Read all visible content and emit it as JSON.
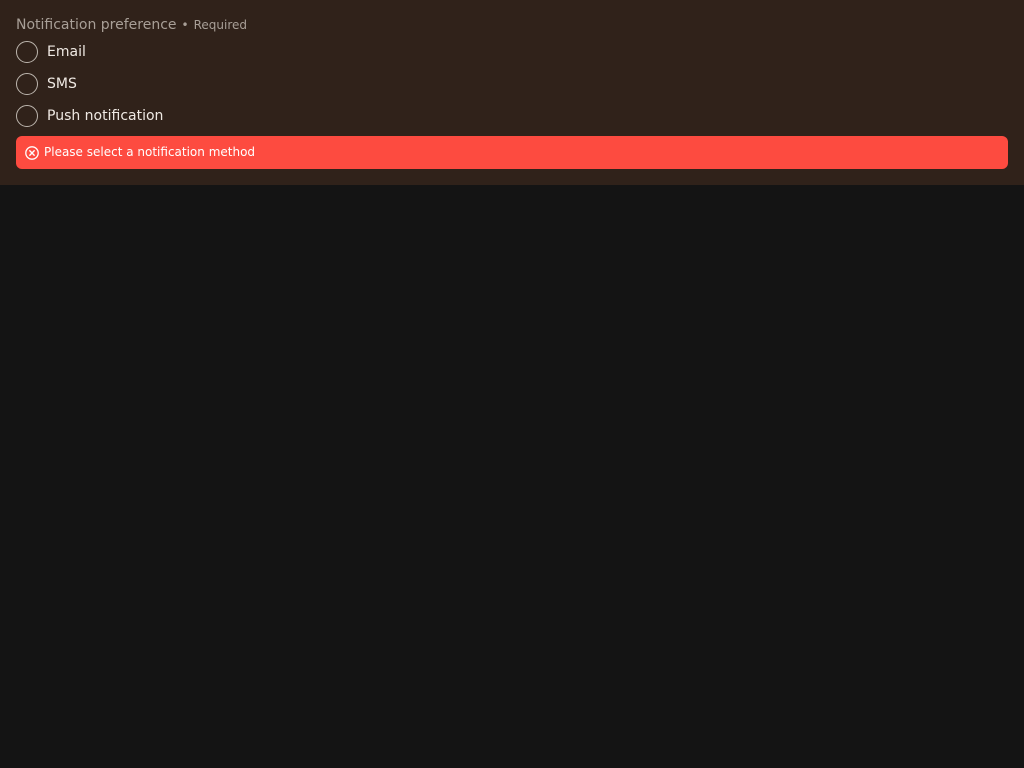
{
  "form": {
    "field_label": "Notification preference",
    "required_separator": "•",
    "required_label": "Required",
    "options": [
      {
        "label": "Email",
        "selected": false
      },
      {
        "label": "SMS",
        "selected": false
      },
      {
        "label": "Push notification",
        "selected": false
      }
    ],
    "error": {
      "icon": "error-circle-x-icon",
      "message": "Please select a notification method"
    }
  },
  "colors": {
    "page_background": "#141414",
    "panel_background": "#30221a",
    "error_background": "#fd4b40",
    "label_text": "#a89f97",
    "option_text": "#efe9e3"
  }
}
